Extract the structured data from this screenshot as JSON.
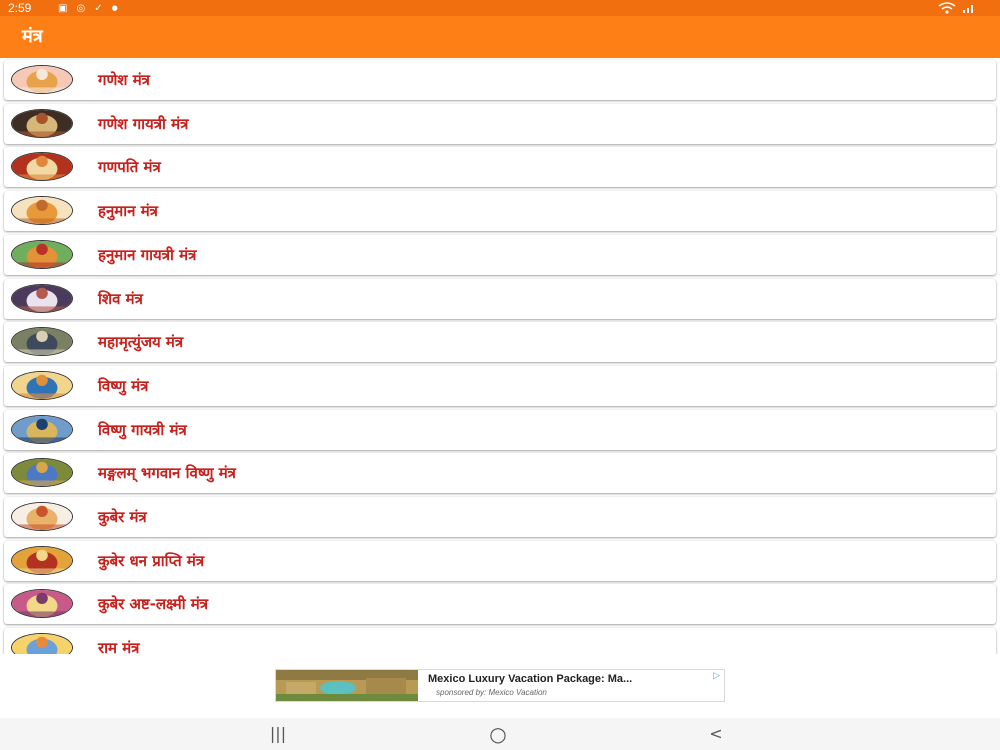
{
  "status_bar": {
    "time": "2:59",
    "left_icons": [
      "image-icon",
      "sync-icon",
      "download-icon",
      "dot-icon"
    ],
    "right_icons": [
      "wifi-icon",
      "signal-icon"
    ]
  },
  "app_bar": {
    "title": "मंत्र"
  },
  "list": {
    "items": [
      {
        "label": "गणेश मंत्र",
        "avatar": "ganesh-avatar",
        "colors": [
          "#f6c9b6",
          "#e8a24a",
          "#f5e8da"
        ]
      },
      {
        "label": "गणेश गायत्री मंत्र",
        "avatar": "ganesh-avatar",
        "colors": [
          "#3e2d25",
          "#d7b679",
          "#a8532c"
        ]
      },
      {
        "label": "गणपति मंत्र",
        "avatar": "ganpati-avatar",
        "colors": [
          "#b3321e",
          "#f0d9a4",
          "#e1863a"
        ]
      },
      {
        "label": "हनुमान मंत्र",
        "avatar": "hanuman-avatar",
        "colors": [
          "#f7e2c0",
          "#e89a3a",
          "#c26a2b"
        ]
      },
      {
        "label": "हनुमान गायत्री मंत्र",
        "avatar": "hanuman-avatar",
        "colors": [
          "#6fae5c",
          "#e29337",
          "#b8322a"
        ]
      },
      {
        "label": "शिव मंत्र",
        "avatar": "shiva-avatar",
        "colors": [
          "#4b3a5b",
          "#e8e3ee",
          "#b45b4f"
        ]
      },
      {
        "label": "महामृत्युंजय मंत्र",
        "avatar": "shiva-avatar",
        "colors": [
          "#7a8063",
          "#3e4a5a",
          "#d9cfb4"
        ]
      },
      {
        "label": "विष्णु मंत्र",
        "avatar": "vishnu-avatar",
        "colors": [
          "#f2d58c",
          "#2f74b6",
          "#e1903a"
        ]
      },
      {
        "label": "विष्णु गायत्री मंत्र",
        "avatar": "vishnu-avatar",
        "colors": [
          "#6f9ccb",
          "#d8b65e",
          "#1f3f70"
        ]
      },
      {
        "label": "मङ्गलम् भगवान विष्णु मंत्र",
        "avatar": "vishnu-avatar",
        "colors": [
          "#7c8a3a",
          "#4d79c4",
          "#d8a64a"
        ]
      },
      {
        "label": "कुबेर मंत्र",
        "avatar": "kuber-avatar",
        "colors": [
          "#f8efe4",
          "#e8b26a",
          "#c9552c"
        ]
      },
      {
        "label": "कुबेर धन प्राप्ति मंत्र",
        "avatar": "kuber-avatar",
        "colors": [
          "#e3a23a",
          "#b3321f",
          "#f2d68a"
        ]
      },
      {
        "label": "कुबेर अष्ट-लक्ष्मी मंत्र",
        "avatar": "lakshmi-avatar",
        "colors": [
          "#c85a8a",
          "#f4d88a",
          "#7a3a6a"
        ]
      },
      {
        "label": "राम मंत्र",
        "avatar": "ram-avatar",
        "colors": [
          "#f5d36a",
          "#6ca0d8",
          "#e88a3a"
        ]
      }
    ]
  },
  "ad": {
    "title": "Mexico Luxury Vacation Package: Ma...",
    "sponsor": "sponsored by: Mexico Vacation",
    "choice_icon": "adchoices-icon"
  },
  "nav_bar": {
    "recents": "|||",
    "home": "○",
    "back": "<"
  },
  "colors": {
    "status_bar": "#f26f0f",
    "app_bar": "#ff7f17",
    "item_text": "#c8201c"
  }
}
